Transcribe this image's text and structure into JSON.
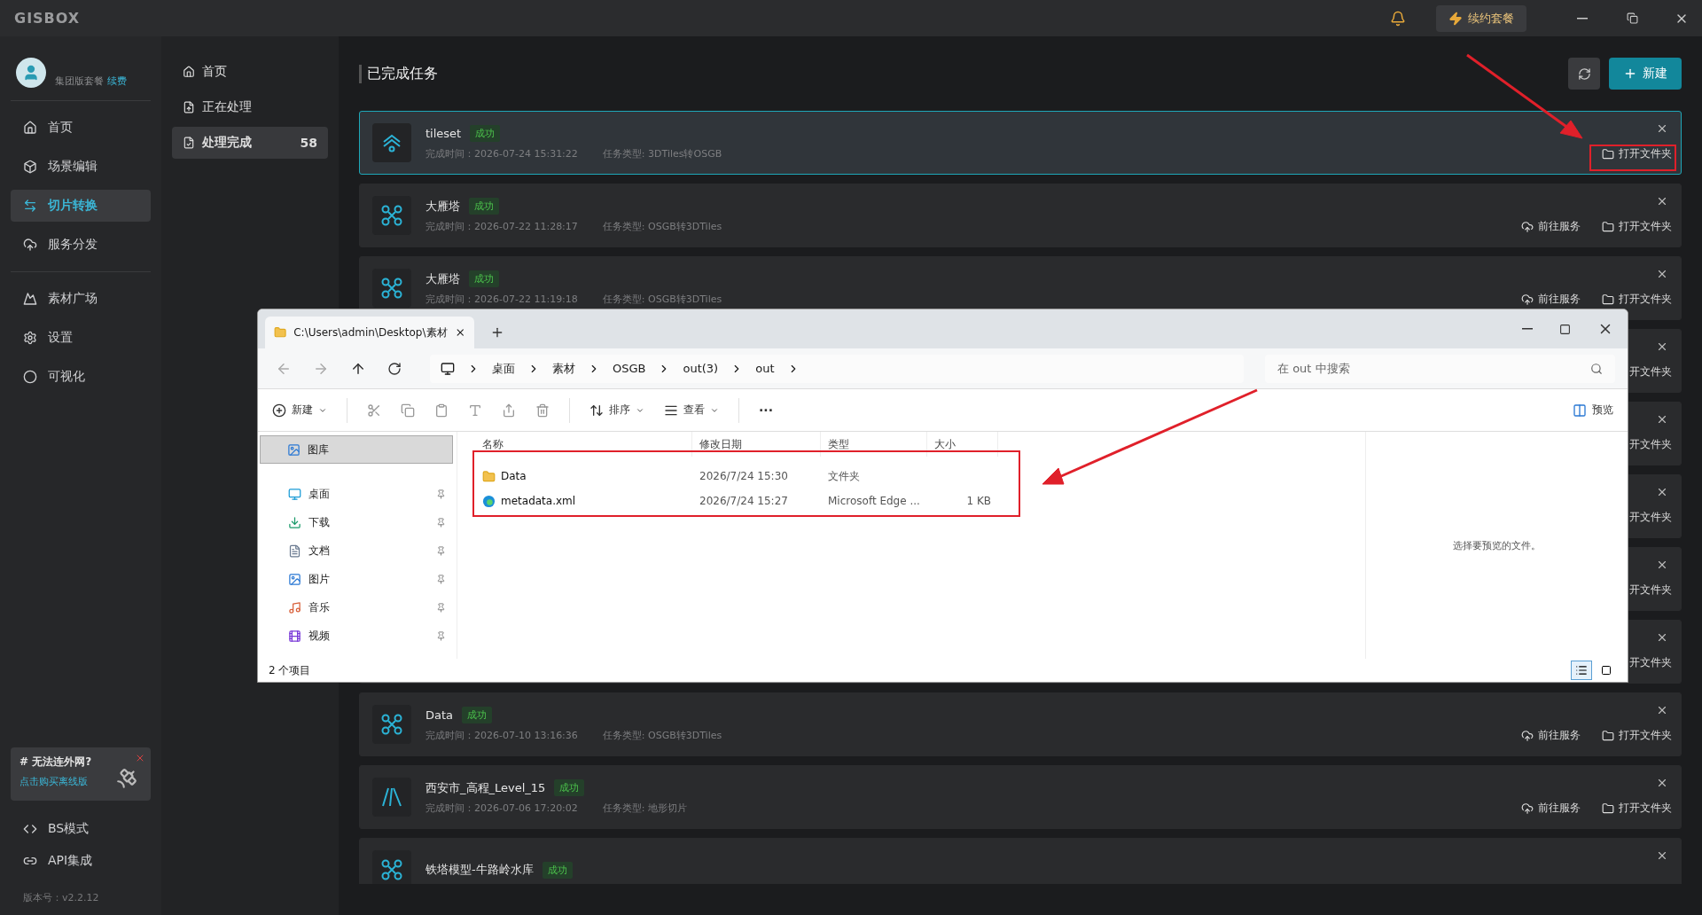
{
  "app": {
    "logo": "GISBOX",
    "renew_button": "续约套餐"
  },
  "user": {
    "plan": "集团版套餐",
    "renew_link": "续费"
  },
  "sidebar": {
    "groups": [
      [
        {
          "label": "首页",
          "selected": false
        },
        {
          "label": "场景编辑",
          "selected": false
        },
        {
          "label": "切片转换",
          "selected": true
        },
        {
          "label": "服务分发",
          "selected": false
        }
      ],
      [
        {
          "label": "素材广场",
          "selected": false
        },
        {
          "label": "设置",
          "selected": false
        },
        {
          "label": "可视化",
          "selected": false
        }
      ]
    ],
    "promo": {
      "title": "# 无法连外网?",
      "link": "点击购买离线版"
    },
    "bottom": [
      "BS模式",
      "API集成"
    ],
    "version": "版本号：v2.2.12"
  },
  "subnav": [
    {
      "label": "首页",
      "selected": false
    },
    {
      "label": "正在处理",
      "selected": false
    },
    {
      "label": "处理完成",
      "selected": true,
      "count": "58"
    }
  ],
  "main": {
    "title": "已完成任务",
    "new_button": "新建",
    "tasks": [
      {
        "kind": "tileset",
        "title": "tileset",
        "status": "成功",
        "time": "完成时间：2026-07-24 15:31:22",
        "type": "任务类型: 3DTiles转OSGB",
        "selected": true,
        "actions": [
          {
            "kind": "folder",
            "label": "打开文件夹"
          }
        ]
      },
      {
        "kind": "drone",
        "title": "大雁塔",
        "status": "成功",
        "time": "完成时间：2026-07-22 11:28:17",
        "type": "任务类型: OSGB转3DTiles",
        "selected": false,
        "actions": [
          {
            "kind": "service",
            "label": "前往服务"
          },
          {
            "kind": "folder",
            "label": "打开文件夹"
          }
        ]
      },
      {
        "kind": "drone",
        "title": "大雁塔",
        "status": "成功",
        "time": "完成时间：2026-07-22 11:19:18",
        "type": "任务类型: OSGB转3DTiles",
        "selected": false,
        "actions": [
          {
            "kind": "service",
            "label": "前往服务"
          },
          {
            "kind": "folder",
            "label": "打开文件夹"
          }
        ]
      },
      {
        "kind": "covered",
        "selected": false,
        "actions": [
          {
            "kind": "covered",
            "label": "开文件夹"
          }
        ]
      },
      {
        "kind": "covered",
        "selected": false,
        "actions": [
          {
            "kind": "covered",
            "label": "开文件夹"
          }
        ]
      },
      {
        "kind": "covered",
        "selected": false,
        "actions": [
          {
            "kind": "covered",
            "label": "开文件夹"
          }
        ]
      },
      {
        "kind": "covered",
        "selected": false,
        "actions": [
          {
            "kind": "covered",
            "label": "开文件夹"
          }
        ]
      },
      {
        "kind": "covered",
        "selected": false,
        "actions": [
          {
            "kind": "covered",
            "label": "开文件夹"
          }
        ]
      },
      {
        "kind": "drone",
        "title": "Data",
        "status": "成功",
        "time": "完成时间：2026-07-10 13:16:36",
        "type": "任务类型: OSGB转3DTiles",
        "selected": false,
        "actions": [
          {
            "kind": "service",
            "label": "前往服务"
          },
          {
            "kind": "folder",
            "label": "打开文件夹"
          }
        ]
      },
      {
        "kind": "terrain",
        "title": "西安市_高程_Level_15",
        "status": "成功",
        "time": "完成时间：2026-07-06 17:20:02",
        "type": "任务类型: 地形切片",
        "selected": false,
        "actions": [
          {
            "kind": "service",
            "label": "前往服务"
          },
          {
            "kind": "folder",
            "label": "打开文件夹"
          }
        ]
      },
      {
        "kind": "drone",
        "title": "铁塔模型-牛路岭水库",
        "status": "成功",
        "selected": false
      }
    ]
  },
  "explorer": {
    "tab": "C:\\Users\\admin\\Desktop\\素材",
    "breadcrumb": [
      "桌面",
      "素材",
      "OSGB",
      "out(3)",
      "out"
    ],
    "search": {
      "placeholder": "在 out 中搜索"
    },
    "toolbar": {
      "new": "新建",
      "sort": "排序",
      "view": "查看",
      "more": "···",
      "preview": "预览"
    },
    "nav": [
      {
        "label": "图库",
        "selected": true,
        "pinned": false
      },
      {
        "label": "桌面",
        "selected": false,
        "pinned": true
      },
      {
        "label": "下载",
        "selected": false,
        "pinned": true
      },
      {
        "label": "文档",
        "selected": false,
        "pinned": true
      },
      {
        "label": "图片",
        "selected": false,
        "pinned": true
      },
      {
        "label": "音乐",
        "selected": false,
        "pinned": true
      },
      {
        "label": "视频",
        "selected": false,
        "pinned": true
      }
    ],
    "columns": [
      "名称",
      "修改日期",
      "类型",
      "大小"
    ],
    "rows": [
      {
        "kind": "folder",
        "name": "Data",
        "date": "2026/7/24 15:30",
        "type": "文件夹"
      },
      {
        "kind": "file",
        "name": "metadata.xml",
        "date": "2026/7/24 15:27",
        "type": "Microsoft Edge ...",
        "size": "1 KB"
      }
    ],
    "preview_hint": "选择要预览的文件。",
    "status": "2 个项目",
    "views": [
      {
        "kind": "details",
        "selected": true
      },
      {
        "kind": "tiles",
        "selected": false
      }
    ]
  }
}
